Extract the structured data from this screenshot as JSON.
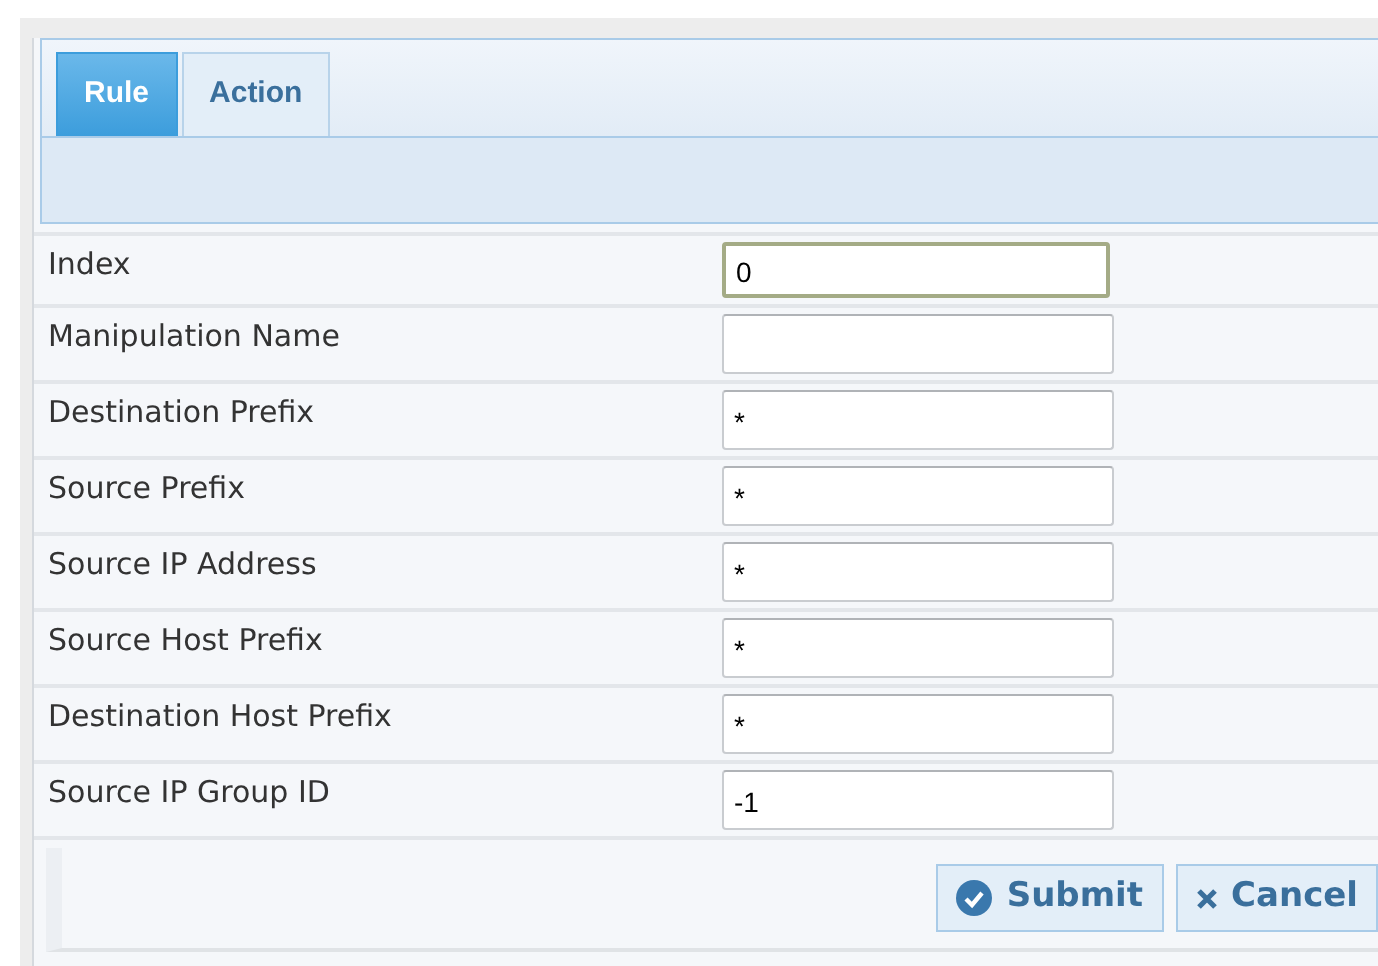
{
  "tabs": [
    {
      "label": "Rule",
      "selected": true
    },
    {
      "label": "Action",
      "selected": false
    }
  ],
  "fields": [
    {
      "label": "Index",
      "value": "0",
      "focused": true
    },
    {
      "label": "Manipulation Name",
      "focused": false
    },
    {
      "label": "Destination Prefix",
      "value": "*",
      "focused": false
    },
    {
      "label": "Source Prefix",
      "value": "*",
      "focused": false
    },
    {
      "label": "Source IP Address",
      "value": "*",
      "focused": false
    },
    {
      "label": "Source Host Prefix",
      "value": "*",
      "focused": false
    },
    {
      "label": "Destination Host Prefix",
      "value": "*",
      "focused": false
    },
    {
      "label": "Source IP Group ID",
      "value": "-1",
      "focused": false
    }
  ],
  "buttons": [
    {
      "label": "Submit",
      "kind": "submit"
    },
    {
      "label": "Cancel",
      "kind": "cancel"
    }
  ]
}
